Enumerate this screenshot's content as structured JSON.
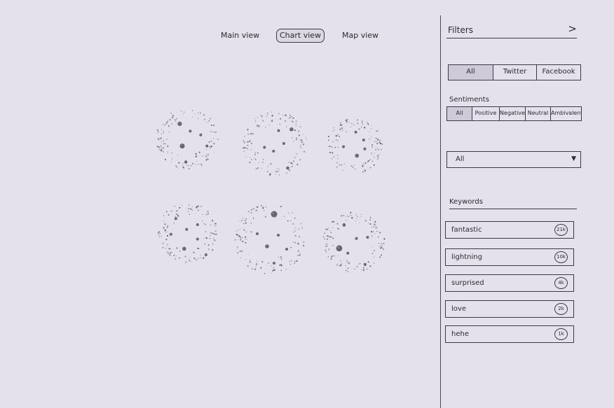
{
  "nav": {
    "main_view": "Main view",
    "chart_view": "Chart view",
    "map_view": "Map view"
  },
  "filters": {
    "title": "Filters",
    "toggle_glyph": ">",
    "sources": [
      "All",
      "Twitter",
      "Facebook"
    ],
    "selected_source": "All",
    "sentiments_title": "Sentiments",
    "sentiments": [
      "All",
      "Positive",
      "Negative",
      "Neutral",
      "Ambivalent"
    ],
    "selected_sentiment": "All",
    "dropdown_value": "All",
    "dropdown_caret": "▼",
    "keywords_title": "Keywords",
    "keywords": [
      {
        "label": "fantastic",
        "count": "21k"
      },
      {
        "label": "lightning",
        "count": "10k"
      },
      {
        "label": "surprised",
        "count": "4k"
      },
      {
        "label": "love",
        "count": "2k"
      },
      {
        "label": "hehe",
        "count": "1k"
      }
    ]
  },
  "colors": {
    "background": "#e5e1ec",
    "ink": "#2a2a30",
    "selected_fill": "#cfcad7",
    "bubble_fill": "#4a4650"
  },
  "chart_data": {
    "type": "scatter",
    "title": "",
    "xlabel": "",
    "ylabel": "",
    "note_on_values": "hand-drawn bubble clusters; no axes or labels printed",
    "charts": [
      {
        "bubbles": [
          {
            "x": 0.38,
            "y": 0.26,
            "r": 0.14
          },
          {
            "x": 0.55,
            "y": 0.38,
            "r": 0.08
          },
          {
            "x": 0.42,
            "y": 0.62,
            "r": 0.16
          },
          {
            "x": 0.72,
            "y": 0.44,
            "r": 0.06
          },
          {
            "x": 0.48,
            "y": 0.88,
            "r": 0.1
          },
          {
            "x": 0.82,
            "y": 0.62,
            "r": 0.07
          }
        ]
      },
      {
        "bubbles": [
          {
            "x": 0.76,
            "y": 0.28,
            "r": 0.12
          },
          {
            "x": 0.56,
            "y": 0.3,
            "r": 0.05
          },
          {
            "x": 0.34,
            "y": 0.56,
            "r": 0.06
          },
          {
            "x": 0.48,
            "y": 0.62,
            "r": 0.08
          },
          {
            "x": 0.64,
            "y": 0.5,
            "r": 0.06
          },
          {
            "x": 0.7,
            "y": 0.88,
            "r": 0.1
          }
        ]
      },
      {
        "bubbles": [
          {
            "x": 0.52,
            "y": 0.26,
            "r": 0.07
          },
          {
            "x": 0.66,
            "y": 0.4,
            "r": 0.1
          },
          {
            "x": 0.3,
            "y": 0.52,
            "r": 0.08
          },
          {
            "x": 0.54,
            "y": 0.68,
            "r": 0.14
          },
          {
            "x": 0.68,
            "y": 0.56,
            "r": 0.05
          }
        ]
      },
      {
        "bubbles": [
          {
            "x": 0.3,
            "y": 0.26,
            "r": 0.06
          },
          {
            "x": 0.66,
            "y": 0.36,
            "r": 0.07
          },
          {
            "x": 0.48,
            "y": 0.44,
            "r": 0.09
          },
          {
            "x": 0.22,
            "y": 0.52,
            "r": 0.1
          },
          {
            "x": 0.66,
            "y": 0.6,
            "r": 0.06
          },
          {
            "x": 0.44,
            "y": 0.76,
            "r": 0.13
          },
          {
            "x": 0.8,
            "y": 0.86,
            "r": 0.08
          }
        ]
      },
      {
        "bubbles": [
          {
            "x": 0.56,
            "y": 0.14,
            "r": 0.18
          },
          {
            "x": 0.32,
            "y": 0.42,
            "r": 0.06
          },
          {
            "x": 0.62,
            "y": 0.44,
            "r": 0.06
          },
          {
            "x": 0.46,
            "y": 0.6,
            "r": 0.11
          },
          {
            "x": 0.56,
            "y": 0.84,
            "r": 0.05
          },
          {
            "x": 0.74,
            "y": 0.64,
            "r": 0.05
          }
        ]
      },
      {
        "bubbles": [
          {
            "x": 0.34,
            "y": 0.22,
            "r": 0.11
          },
          {
            "x": 0.54,
            "y": 0.44,
            "r": 0.06
          },
          {
            "x": 0.26,
            "y": 0.6,
            "r": 0.2
          },
          {
            "x": 0.4,
            "y": 0.68,
            "r": 0.09
          },
          {
            "x": 0.68,
            "y": 0.86,
            "r": 0.08
          },
          {
            "x": 0.72,
            "y": 0.42,
            "r": 0.05
          }
        ]
      }
    ]
  }
}
